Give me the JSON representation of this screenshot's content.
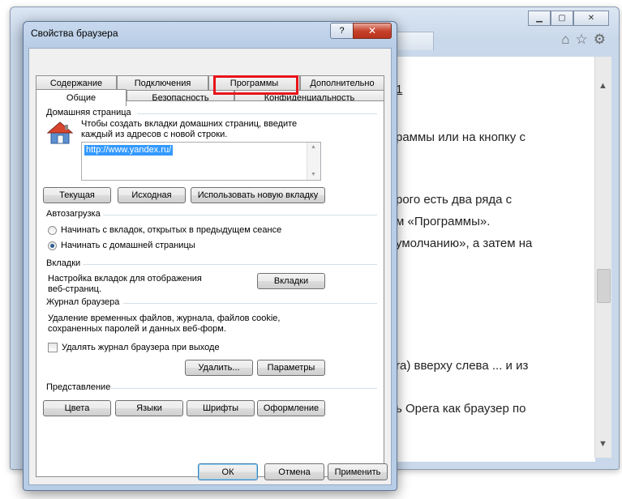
{
  "background": {
    "content_lines": [
      "1",
      "раммы или на кнопку с",
      "рого есть два ряда с",
      "м «Программы».",
      "умолчанию», а затем на",
      "ra) вверху слева ... и из",
      "ь Opera как браузер по"
    ]
  },
  "dialog": {
    "title": "Свойства браузера",
    "help_label": "?",
    "close_label": "✕",
    "tabs_back": [
      "Содержание",
      "Подключения",
      "Программы",
      "Дополнительно"
    ],
    "tabs_front": [
      "Общие",
      "Безопасность",
      "Конфиденциальность"
    ],
    "home": {
      "header": "Домашняя страница",
      "description": [
        "Чтобы создать вкладки домашних страниц, введите",
        "каждый из адресов с новой строки."
      ],
      "url": "http://www.yandex.ru/",
      "btn_current": "Текущая",
      "btn_default": "Исходная",
      "btn_new_tab": "Использовать новую вкладку"
    },
    "startup": {
      "header": "Автозагрузка",
      "opt_last": "Начинать с вкладок, открытых в предыдущем сеансе",
      "opt_home": "Начинать с домашней страницы"
    },
    "tabs_group": {
      "header": "Вкладки",
      "description": [
        "Настройка вкладок для отображения",
        "веб-страниц."
      ],
      "btn": "Вкладки"
    },
    "history": {
      "header": "Журнал браузера",
      "description": [
        "Удаление временных файлов, журнала, файлов cookie,",
        "сохраненных паролей и данных веб-форм."
      ],
      "checkbox": "Удалять журнал браузера при выходе",
      "btn_delete": "Удалить...",
      "btn_settings": "Параметры"
    },
    "appearance": {
      "header": "Представление",
      "btn_colors": "Цвета",
      "btn_languages": "Языки",
      "btn_fonts": "Шрифты",
      "btn_accessibility": "Оформление"
    },
    "footer": {
      "ok": "ОК",
      "cancel": "Отмена",
      "apply": "Применить"
    }
  }
}
